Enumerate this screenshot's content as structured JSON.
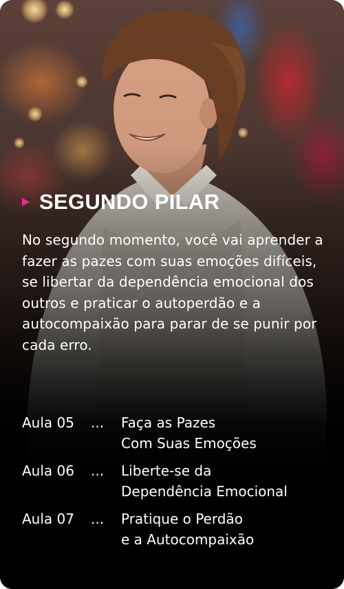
{
  "section": {
    "title": "SEGUNDO PILAR",
    "description": "No segundo momento, você vai aprender a fazer as pazes com suas emoções difíceis, se libertar da dependência emocional dos outros e praticar o autoperdão e a autocompaixão para parar de se punir por cada erro.",
    "accent_color": "#e8308a",
    "arrow_icon": "play-triangle-icon"
  },
  "lessons": [
    {
      "number": "Aula 05",
      "separator": "...",
      "title_line1": "Faça as Pazes",
      "title_line2": "Com Suas Emoções"
    },
    {
      "number": "Aula 06",
      "separator": "...",
      "title_line1": "Liberte-se da",
      "title_line2": "Dependência Emocional"
    },
    {
      "number": "Aula 07",
      "separator": "...",
      "title_line1": "Pratique o Perdão",
      "title_line2": "e a Autocompaixão"
    }
  ]
}
